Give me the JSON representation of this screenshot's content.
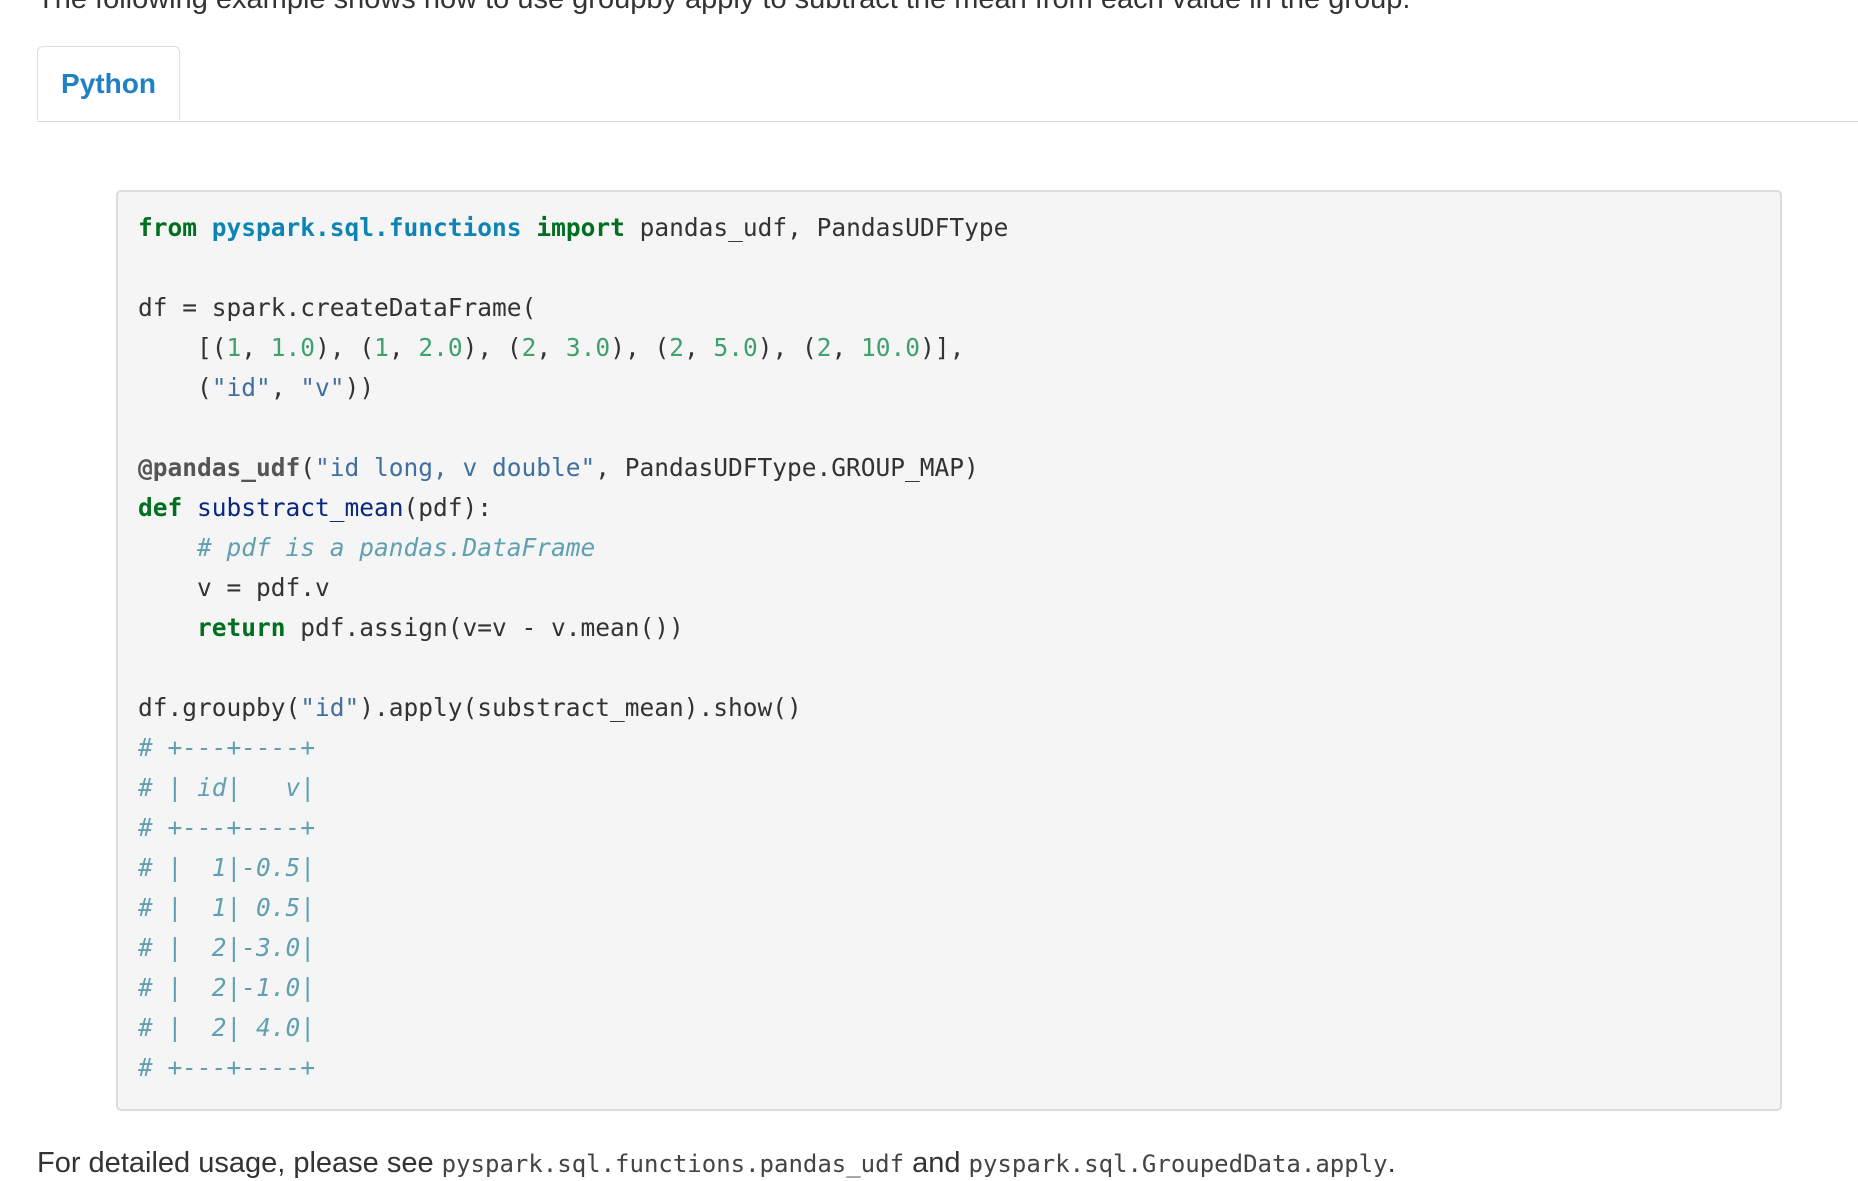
{
  "intro_text": "The following example shows how to use groupby apply to subtract the mean from each value in the group.",
  "tabs": [
    {
      "label": "Python",
      "active": true
    }
  ],
  "code": {
    "lines": [
      [
        {
          "t": "from",
          "c": "kw"
        },
        {
          "t": " ",
          "c": ""
        },
        {
          "t": "pyspark.sql.functions",
          "c": "mod"
        },
        {
          "t": " ",
          "c": ""
        },
        {
          "t": "import",
          "c": "kw"
        },
        {
          "t": " pandas_udf, PandasUDFType",
          "c": ""
        }
      ],
      [],
      [
        {
          "t": "df = spark.createDataFrame(",
          "c": ""
        }
      ],
      [
        {
          "t": "    [(",
          "c": ""
        },
        {
          "t": "1",
          "c": "num"
        },
        {
          "t": ", ",
          "c": ""
        },
        {
          "t": "1.0",
          "c": "num"
        },
        {
          "t": "), (",
          "c": ""
        },
        {
          "t": "1",
          "c": "num"
        },
        {
          "t": ", ",
          "c": ""
        },
        {
          "t": "2.0",
          "c": "num"
        },
        {
          "t": "), (",
          "c": ""
        },
        {
          "t": "2",
          "c": "num"
        },
        {
          "t": ", ",
          "c": ""
        },
        {
          "t": "3.0",
          "c": "num"
        },
        {
          "t": "), (",
          "c": ""
        },
        {
          "t": "2",
          "c": "num"
        },
        {
          "t": ", ",
          "c": ""
        },
        {
          "t": "5.0",
          "c": "num"
        },
        {
          "t": "), (",
          "c": ""
        },
        {
          "t": "2",
          "c": "num"
        },
        {
          "t": ", ",
          "c": ""
        },
        {
          "t": "10.0",
          "c": "num"
        },
        {
          "t": ")],",
          "c": ""
        }
      ],
      [
        {
          "t": "    (",
          "c": ""
        },
        {
          "t": "\"id\"",
          "c": "str"
        },
        {
          "t": ", ",
          "c": ""
        },
        {
          "t": "\"v\"",
          "c": "str"
        },
        {
          "t": "))",
          "c": ""
        }
      ],
      [],
      [
        {
          "t": "@pandas_udf",
          "c": "dec"
        },
        {
          "t": "(",
          "c": ""
        },
        {
          "t": "\"id long, v double\"",
          "c": "str"
        },
        {
          "t": ", PandasUDFType.GROUP_MAP)",
          "c": ""
        }
      ],
      [
        {
          "t": "def",
          "c": "kw"
        },
        {
          "t": " ",
          "c": ""
        },
        {
          "t": "substract_mean",
          "c": "fn"
        },
        {
          "t": "(pdf):",
          "c": ""
        }
      ],
      [
        {
          "t": "    ",
          "c": ""
        },
        {
          "t": "# pdf is a pandas.DataFrame",
          "c": "cm"
        }
      ],
      [
        {
          "t": "    v = pdf.v",
          "c": ""
        }
      ],
      [
        {
          "t": "    ",
          "c": ""
        },
        {
          "t": "return",
          "c": "kw"
        },
        {
          "t": " pdf.assign(v=v - v.mean())",
          "c": ""
        }
      ],
      [],
      [
        {
          "t": "df.groupby(",
          "c": ""
        },
        {
          "t": "\"id\"",
          "c": "str"
        },
        {
          "t": ").apply(substract_mean).show()",
          "c": ""
        }
      ],
      [
        {
          "t": "# +---+----+",
          "c": "cm"
        }
      ],
      [
        {
          "t": "# | id|   v|",
          "c": "cm"
        }
      ],
      [
        {
          "t": "# +---+----+",
          "c": "cm"
        }
      ],
      [
        {
          "t": "# |  1|-0.5|",
          "c": "cm"
        }
      ],
      [
        {
          "t": "# |  1| 0.5|",
          "c": "cm"
        }
      ],
      [
        {
          "t": "# |  2|-3.0|",
          "c": "cm"
        }
      ],
      [
        {
          "t": "# |  2|-1.0|",
          "c": "cm"
        }
      ],
      [
        {
          "t": "# |  2| 4.0|",
          "c": "cm"
        }
      ],
      [
        {
          "t": "# +---+----+",
          "c": "cm"
        }
      ]
    ]
  },
  "outro": {
    "prefix": "For detailed usage, please see ",
    "link1": "pyspark.sql.functions.pandas_udf",
    "middle": " and ",
    "link2": "pyspark.sql.GroupedData.apply",
    "suffix": "."
  }
}
